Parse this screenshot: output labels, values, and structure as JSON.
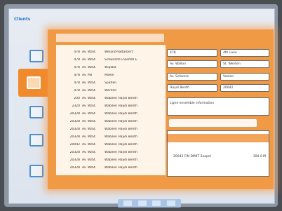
{
  "app": {
    "title": "Clients"
  },
  "sidebar": {
    "items": [
      {
        "icon": "home-icon"
      },
      {
        "icon": "book-icon"
      },
      {
        "icon": "list-icon"
      },
      {
        "icon": "document-icon"
      },
      {
        "icon": "user-card-icon"
      }
    ]
  },
  "list": {
    "rows": [
      {
        "num": "478",
        "a": "Av. Wallon",
        "b": "St.",
        "c": "Weland-Valtarbert"
      },
      {
        "num": "478",
        "a": "Av. Wallon",
        "b": "St.",
        "c": "Schwarzd Ensembl E"
      },
      {
        "num": "478",
        "a": "Av. Wallon",
        "b": "St.",
        "c": "Wiplatz"
      },
      {
        "num": "478",
        "a": "Av. Malmerich",
        "b": "",
        "c": "Malen"
      },
      {
        "num": "478",
        "a": "Av. Wallon",
        "b": "St.",
        "c": "Spatlen"
      },
      {
        "num": "478",
        "a": "Av. Wallon",
        "b": "St.",
        "c": "Wenten"
      },
      {
        "num": "200",
        "a": "Av. Wallon",
        "b": "St.",
        "c": "Wabilen Haydi Benth"
      },
      {
        "num": "2320",
        "a": "Av. Wallon",
        "b": "St.",
        "c": "Wabilen Haydi Benth"
      },
      {
        "num": "20328",
        "a": "Av. Wallon",
        "b": "St.",
        "c": "Wabilen Haydi Benth"
      },
      {
        "num": "20328",
        "a": "Av. Wallon",
        "b": "St.",
        "c": "Wabilen Haydi Benth"
      },
      {
        "num": "20328",
        "a": "Av. Wallon",
        "b": "St.",
        "c": "Wabilen Haydi Benth"
      },
      {
        "num": "20328",
        "a": "Av. Wallon",
        "b": "St.",
        "c": "Wabilen Haydi Benth"
      },
      {
        "num": "20042",
        "a": "Av. Wallon",
        "b": "St.",
        "c": "Wabilen Haydi Benth"
      },
      {
        "num": "20328",
        "a": "Av. Wallon",
        "b": "St.",
        "c": "Wabilen Haydi Benth"
      },
      {
        "num": "20328",
        "a": "Av. Wallon",
        "b": "St.",
        "c": "Wabilen Haydi Benth"
      },
      {
        "num": "20328",
        "a": "Av. Wallon",
        "b": "St.",
        "c": "Wabilen Haydi Benth"
      }
    ]
  },
  "form": {
    "fields": [
      {
        "value": "478"
      },
      {
        "value": "4th Lane"
      },
      {
        "value": "Av. Wallon"
      },
      {
        "value": "St. Wenten"
      },
      {
        "value": "Av. Schwarz"
      },
      {
        "value": "Vanlen"
      },
      {
        "value": "Haydi Benth"
      },
      {
        "value": "20042"
      }
    ],
    "notes": "Ligne ensemble information",
    "search_placeholder": ""
  },
  "results": {
    "row_label": "20042 FIN DIMIT Soapel",
    "row_value": "100.0 M"
  },
  "pager": {
    "buttons": [
      "first",
      "prev",
      "next",
      "last"
    ]
  },
  "colors": {
    "accent": "#f19a45",
    "brand": "#2f78c8"
  }
}
